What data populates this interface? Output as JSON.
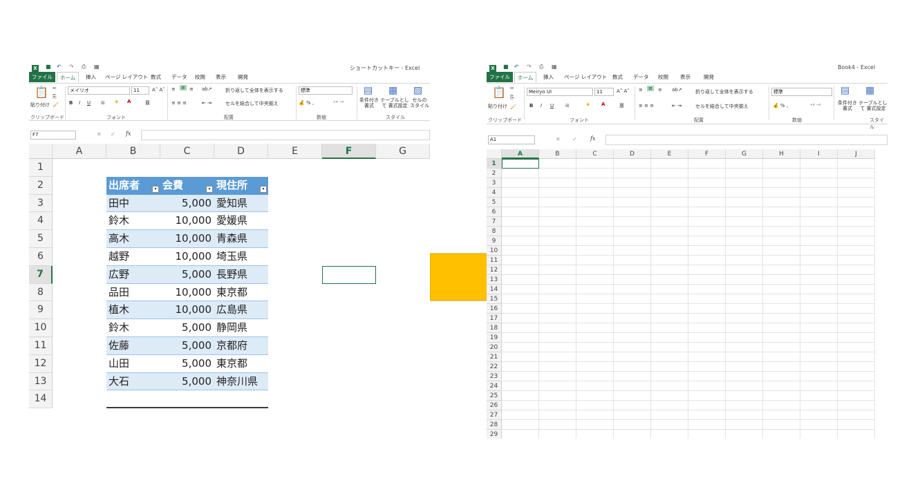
{
  "left": {
    "window_title": "ショートカットキー - Excel",
    "tabs": [
      "ファイル",
      "ホーム",
      "挿入",
      "ページ レイアウト",
      "数式",
      "データ",
      "校閲",
      "表示",
      "開発"
    ],
    "ribbon": {
      "paste": "貼り付け",
      "font_name": "メイリオ",
      "font_size": "11",
      "wrap_text": "折り返して全体を表示する",
      "merge_center": "セルを結合して中央揃え",
      "number_format": "標準",
      "conditional": "条件付き 書式",
      "table_format": "テーブルとして 書式設定",
      "cell_style": "セルの スタイル",
      "groups": [
        "クリップボード",
        "フォント",
        "配置",
        "数値",
        "スタイル"
      ]
    },
    "name_box": "F7",
    "fx": "fx",
    "columns": [
      "A",
      "B",
      "C",
      "D",
      "E",
      "F",
      "G"
    ],
    "rows": [
      "1",
      "2",
      "3",
      "4",
      "5",
      "6",
      "7",
      "8",
      "9",
      "10",
      "11",
      "12",
      "13",
      "14"
    ],
    "table": {
      "headers": [
        "出席者",
        "会費",
        "現住所"
      ],
      "rows": [
        [
          "田中",
          "5,000",
          "愛知県"
        ],
        [
          "鈴木",
          "10,000",
          "愛媛県"
        ],
        [
          "高木",
          "10,000",
          "青森県"
        ],
        [
          "越野",
          "10,000",
          "埼玉県"
        ],
        [
          "広野",
          "5,000",
          "長野県"
        ],
        [
          "品田",
          "10,000",
          "東京都"
        ],
        [
          "植木",
          "10,000",
          "広島県"
        ],
        [
          "鈴木",
          "5,000",
          "静岡県"
        ],
        [
          "佐藤",
          "5,000",
          "京都府"
        ],
        [
          "山田",
          "5,000",
          "東京都"
        ],
        [
          "大石",
          "5,000",
          "神奈川県"
        ]
      ]
    }
  },
  "right": {
    "window_title": "Book4 - Excel",
    "tabs": [
      "ファイル",
      "ホーム",
      "挿入",
      "ページ レイアウト",
      "数式",
      "データ",
      "校閲",
      "表示",
      "開発"
    ],
    "ribbon": {
      "paste": "貼り付け",
      "font_name": "Meiryo UI",
      "font_size": "11",
      "wrap_text": "折り返して全体を表示する",
      "merge_center": "セルを結合して中央揃え",
      "number_format": "標準",
      "conditional": "条件付き 書式",
      "table_format": "テーブルとして 書式設定",
      "groups": [
        "クリップボード",
        "フォント",
        "配置",
        "数値",
        "スタイル"
      ]
    },
    "name_box": "A1",
    "fx": "fx",
    "columns": [
      "A",
      "B",
      "C",
      "D",
      "E",
      "F",
      "G",
      "H",
      "I",
      "J"
    ],
    "rows": [
      "1",
      "2",
      "3",
      "4",
      "5",
      "6",
      "7",
      "8",
      "9",
      "10",
      "11",
      "12",
      "13",
      "14",
      "15",
      "16",
      "17",
      "18",
      "19",
      "20",
      "21",
      "22",
      "23",
      "24",
      "25",
      "26",
      "27",
      "28",
      "29"
    ]
  },
  "colors": {
    "excel_green": "#217346",
    "table_header": "#5b9bd5",
    "table_band": "#ddebf7",
    "arrow": "#ffc000"
  },
  "icons": [
    "excel-logo-icon",
    "save-icon",
    "undo-icon",
    "redo-icon",
    "paste-icon",
    "cut-icon",
    "copy-icon",
    "format-painter-icon",
    "bold-icon",
    "italic-icon",
    "underline-icon",
    "border-icon",
    "fill-color-icon",
    "font-color-icon",
    "align-icon",
    "right-arrow-icon"
  ]
}
